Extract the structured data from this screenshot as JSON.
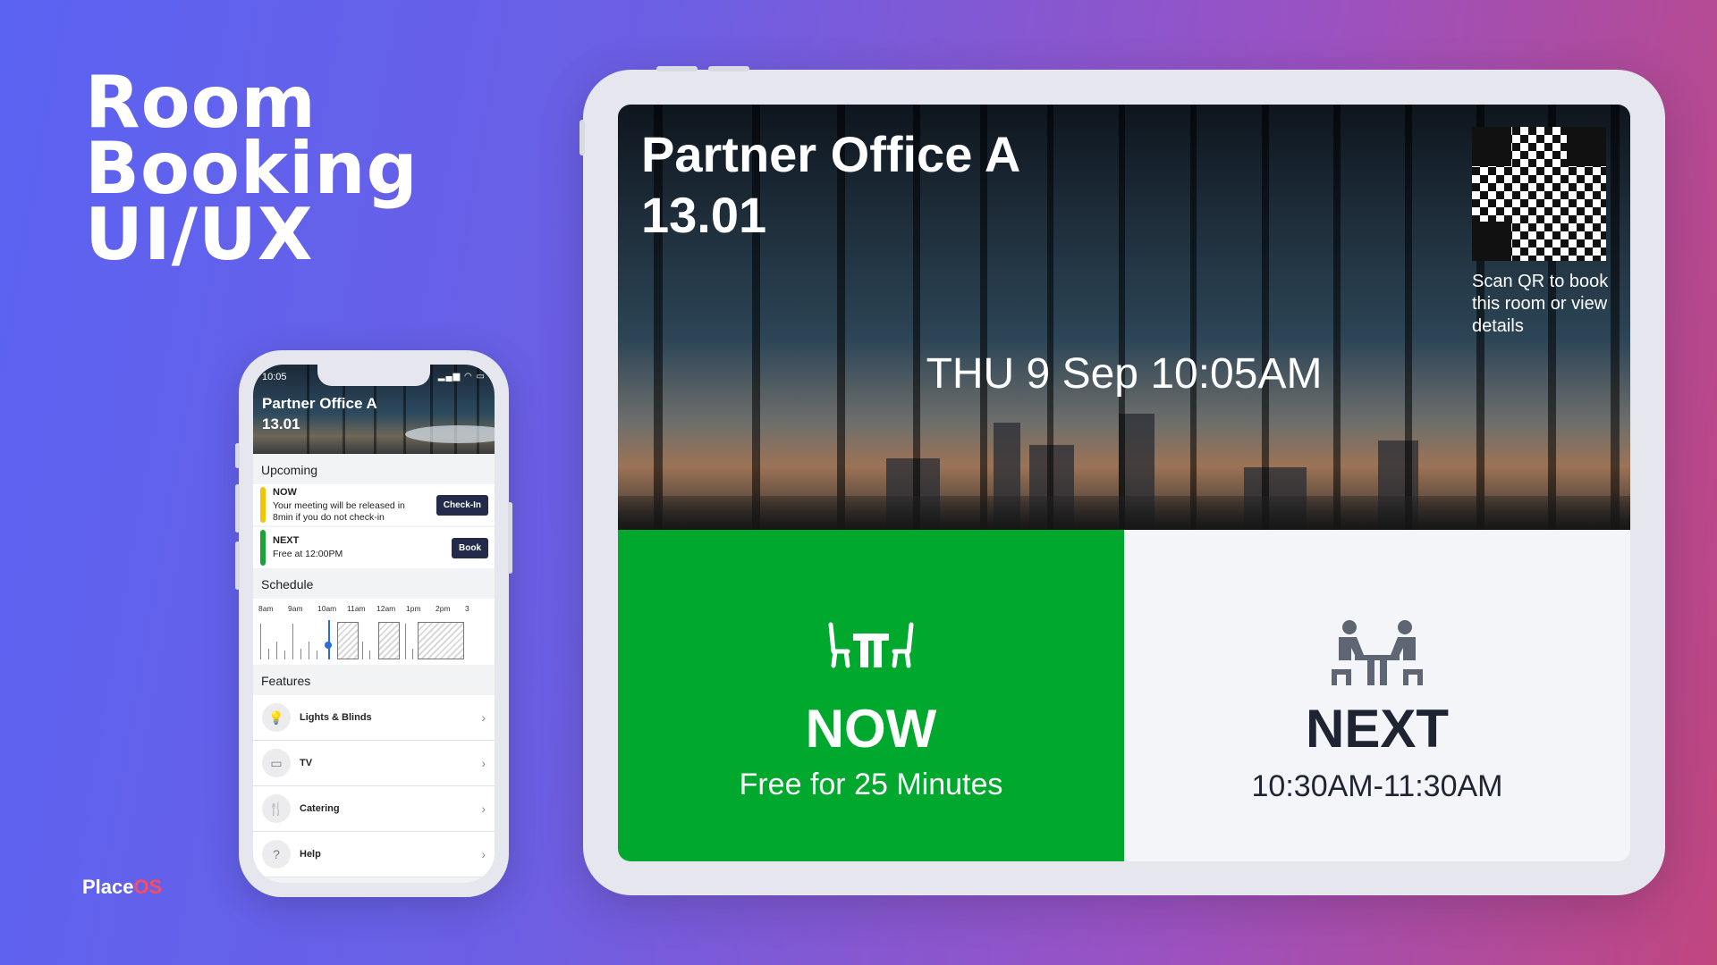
{
  "hero": {
    "line1": "Room",
    "line2": "Booking",
    "line3": "UI/UX"
  },
  "brand": {
    "name": "Place",
    "suffix": "OS",
    "accent": "#ff4b5c"
  },
  "phone": {
    "status_time": "10:05",
    "status_icons": "signal-icon wifi-icon battery-icon",
    "room_line1": "Partner Office A",
    "room_line2": "13.01",
    "upcoming_label": "Upcoming",
    "now_event": {
      "kicker": "NOW",
      "text": "Your meeting will be released in 8min if you do not check-in",
      "button": "Check-In",
      "bar_color": "#f5c400"
    },
    "next_event": {
      "kicker": "NEXT",
      "text": "Free at 12:00PM",
      "button": "Book",
      "bar_color": "#17a538"
    },
    "schedule_label": "Schedule",
    "schedule_hours": [
      "8am",
      "9am",
      "10am",
      "11am",
      "12am",
      "1pm",
      "2pm",
      "3"
    ],
    "features_label": "Features",
    "features": [
      {
        "label": "Lights & Blinds",
        "icon": "lightbulb-icon"
      },
      {
        "label": "TV",
        "icon": "tv-icon"
      },
      {
        "label": "Catering",
        "icon": "cutlery-icon"
      },
      {
        "label": "Help",
        "icon": "help-icon"
      }
    ]
  },
  "tablet": {
    "room_line1": "Partner Office A",
    "room_line2": "13.01",
    "datetime": "THU 9 Sep 10:05AM",
    "qr_caption": "Scan QR  to book this room or view details",
    "now": {
      "title": "NOW",
      "subtitle": "Free for 25 Minutes",
      "icon": "empty-desk-chairs-icon",
      "color": "#00a82d"
    },
    "next": {
      "title": "NEXT",
      "subtitle": "10:30AM-11:30AM",
      "icon": "people-meeting-icon"
    }
  }
}
